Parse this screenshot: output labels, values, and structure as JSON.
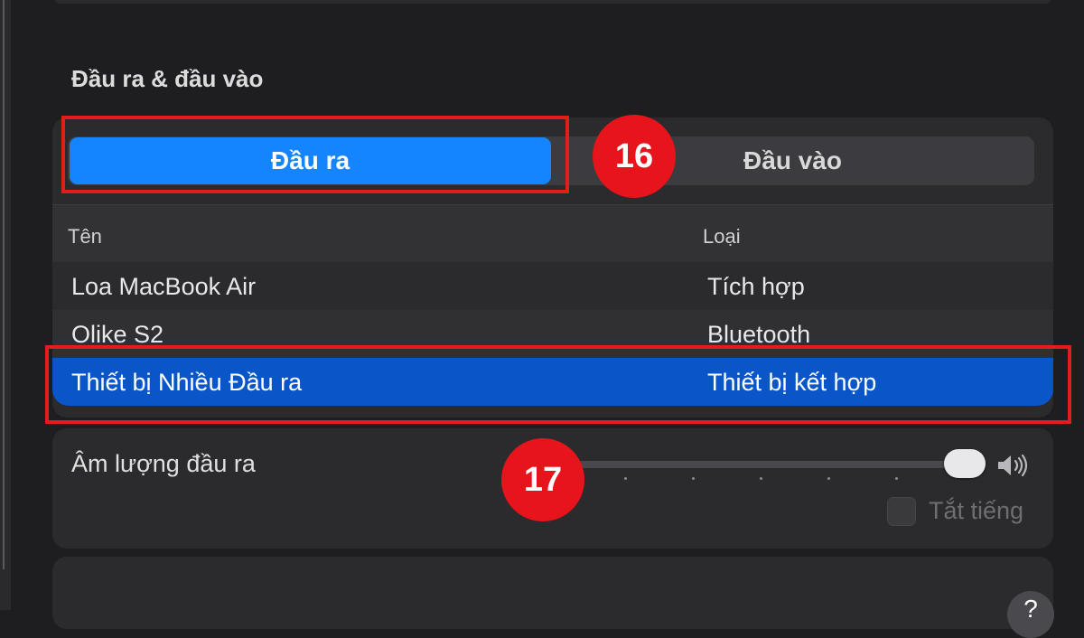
{
  "section_title": "Đầu ra & đầu vào",
  "segmented": {
    "output_label": "Đầu ra",
    "input_label": "Đầu vào",
    "selected": "Đầu ra"
  },
  "table": {
    "headers": {
      "name": "Tên",
      "type": "Loại"
    },
    "rows": [
      {
        "name": "Loa MacBook Air",
        "type": "Tích hợp",
        "selected": false
      },
      {
        "name": "Olike S2",
        "type": "Bluetooth",
        "selected": false
      },
      {
        "name": "Thiết bị Nhiều Đầu ra",
        "type": "Thiết bị kết hợp",
        "selected": true
      }
    ]
  },
  "volume": {
    "label": "Âm lượng đầu ra",
    "level": 1.0,
    "mute_label": "Tắt tiếng",
    "muted": false
  },
  "help": {
    "label": "?"
  },
  "annotations": {
    "step_16": "16",
    "step_17": "17"
  },
  "colors": {
    "accent": "#1584ff",
    "selection": "#0a56c9",
    "highlight": "#e51c1c",
    "badge": "#e8141b",
    "background": "#1e1e21",
    "card": "#2b2b2e"
  }
}
